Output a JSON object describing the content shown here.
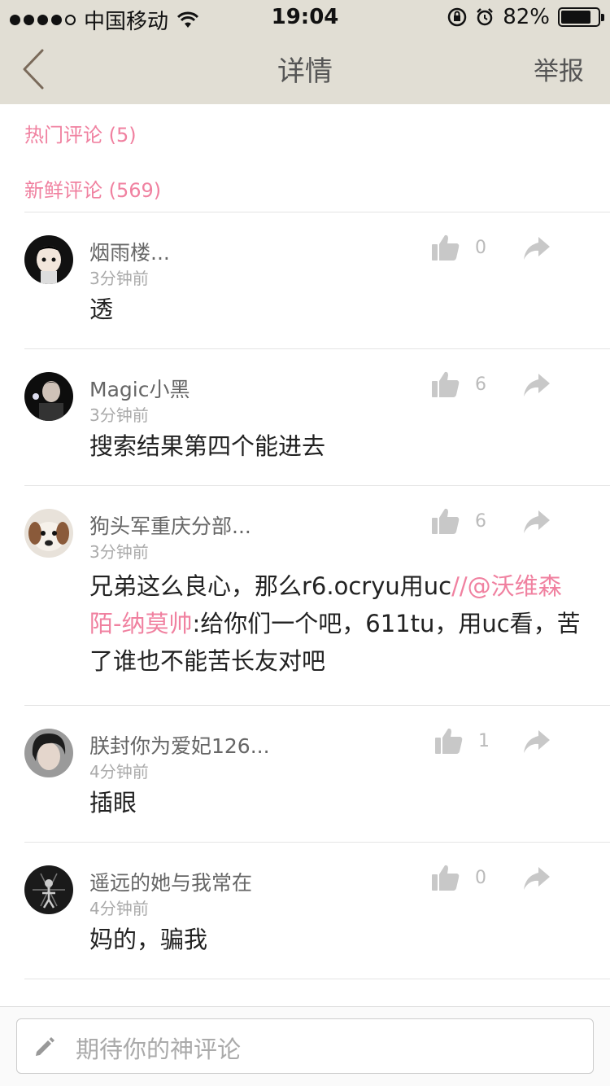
{
  "status_bar": {
    "carrier": "中国移动",
    "time": "19:04",
    "battery_text": "82%",
    "battery_level": 0.82
  },
  "nav": {
    "title": "详情",
    "report_label": "举报"
  },
  "sections": {
    "hot": "热门评论 (5)",
    "new": "新鲜评论 (569)"
  },
  "comments": [
    {
      "name": "烟雨楼...",
      "time": "3分钟前",
      "text": "透",
      "likes": "0"
    },
    {
      "name": "Magic小黑",
      "time": "3分钟前",
      "text": "搜索结果第四个能进去",
      "likes": "6"
    },
    {
      "name": "狗头军重庆分部...",
      "time": "3分钟前",
      "text_before": "兄弟这么良心，那么r6.ocryu用uc",
      "mention": "//@沃维森陌-纳莫帅",
      "text_after": ":给你们一个吧，611tu，用uc看，苦了谁也不能苦长友对吧",
      "likes": "6"
    },
    {
      "name": "朕封你为爱妃126...",
      "time": "4分钟前",
      "text": "插眼",
      "likes": "1"
    },
    {
      "name": "遥远的她与我常在",
      "time": "4分钟前",
      "text": "妈的，骗我",
      "likes": "0"
    }
  ],
  "input": {
    "placeholder": "期待你的神评论"
  },
  "colors": {
    "accent_pink": "#f081a0",
    "topbar_bg": "#e1ded4",
    "icon_gray": "#c8c8c8"
  }
}
